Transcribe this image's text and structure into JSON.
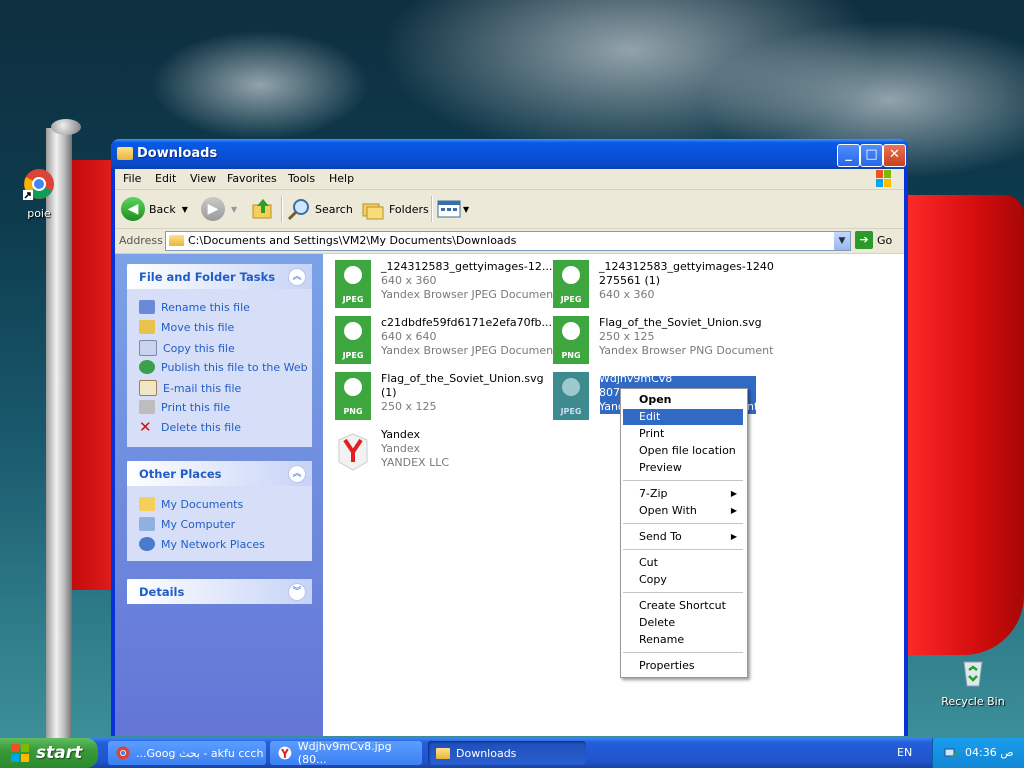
{
  "desktop": {
    "icons": [
      {
        "label": "poie",
        "icon": "chrome-shortcut-icon"
      },
      {
        "label": "Recycle Bin",
        "icon": "recycle-bin-icon"
      }
    ]
  },
  "window": {
    "title": "Downloads",
    "menu": [
      "File",
      "Edit",
      "View",
      "Favorites",
      "Tools",
      "Help"
    ],
    "toolbar": {
      "back": "Back",
      "search": "Search",
      "folders": "Folders"
    },
    "address": {
      "label": "Address",
      "path": "C:\\Documents and Settings\\VM2\\My Documents\\Downloads",
      "go": "Go"
    },
    "left_pane": {
      "file_tasks": {
        "title": "File and Folder Tasks",
        "items": [
          {
            "label": "Rename this file",
            "icon": "rename-icon"
          },
          {
            "label": "Move this file",
            "icon": "move-icon"
          },
          {
            "label": "Copy this file",
            "icon": "copy-icon"
          },
          {
            "label": "Publish this file to the Web",
            "icon": "publish-web-icon"
          },
          {
            "label": "E-mail this file",
            "icon": "email-icon"
          },
          {
            "label": "Print this file",
            "icon": "print-icon"
          },
          {
            "label": "Delete this file",
            "icon": "delete-icon"
          }
        ]
      },
      "other_places": {
        "title": "Other Places",
        "items": [
          {
            "label": "My Documents",
            "icon": "my-documents-icon"
          },
          {
            "label": "My Computer",
            "icon": "my-computer-icon"
          },
          {
            "label": "My Network Places",
            "icon": "network-places-icon"
          }
        ]
      },
      "details": {
        "title": "Details"
      }
    },
    "files": [
      {
        "name": "_124312583_gettyimages-12...",
        "line2": "640 x 360",
        "line3": "Yandex Browser JPEG Document",
        "badge": "JPEG"
      },
      {
        "name": "_124312583_gettyimages-1240",
        "line2": "275561 (1)",
        "line3": "640 x 360",
        "badge": "JPEG"
      },
      {
        "name": "c21dbdfe59fd6171e2efa70fb...",
        "line2": "640 x 640",
        "line3": "Yandex Browser JPEG Document",
        "badge": "JPEG"
      },
      {
        "name": "Flag_of_the_Soviet_Union.svg",
        "line2": "250 x 125",
        "line3": "Yandex Browser PNG Document",
        "badge": "PNG"
      },
      {
        "name": "Flag_of_the_Soviet_Union.svg",
        "line2": "(1)",
        "line3": "250 x 125",
        "badge": "PNG"
      },
      {
        "name": "Wdjhv9mCv8",
        "line2": "807",
        "line3": "Yand",
        "badge": "JPEG"
      },
      {
        "name": "Yandex",
        "line2": "Yandex",
        "line3": "YANDEX LLC",
        "badge": ""
      }
    ],
    "context_menu": {
      "items": [
        "Open",
        "Edit",
        "Print",
        "Open file location",
        "Preview",
        "7-Zip",
        "Open With",
        "Send To",
        "Cut",
        "Copy",
        "Create Shortcut",
        "Delete",
        "Rename",
        "Properties"
      ],
      "highlighted": "Edit",
      "tail_text": "nt"
    }
  },
  "taskbar": {
    "start": "start",
    "tasks": [
      {
        "label": "...Goog بحث - akfu ccch",
        "icon": "chrome-icon"
      },
      {
        "label": "Wdjhv9mCv8.jpg (80...",
        "icon": "yandex-icon"
      },
      {
        "label": "Downloads",
        "icon": "folder-icon"
      }
    ],
    "lang": "EN",
    "clock": "04:36 ص"
  },
  "colors": {
    "xp_blue": "#0831d9",
    "selection": "#316ac5",
    "link_blue": "#215dc6",
    "yandex_green": "#3ea63e"
  }
}
